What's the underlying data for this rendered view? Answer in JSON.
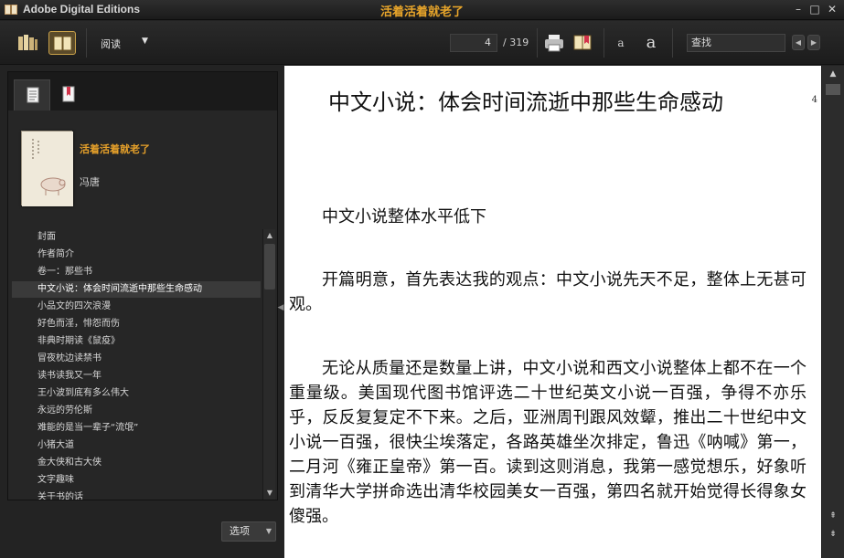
{
  "titlebar": {
    "app_name": "Adobe Digital Editions",
    "document_title": "活着活着就老了",
    "minimize": "–",
    "maximize": "□",
    "close": "✕"
  },
  "toolbar": {
    "view_menu_label": "阅读",
    "page_current": "4",
    "page_total": "/ 319",
    "search_placeholder": "查找",
    "font_smaller": "a",
    "font_larger": "a"
  },
  "library_panel": {
    "book_title": "活着活着就老了",
    "book_author": "冯唐",
    "toc": [
      "封面",
      "作者简介",
      "卷一：那些书",
      "中文小说：体会时间流逝中那些生命感动",
      "小品文的四次浪漫",
      "好色而淫，悱怨而伤",
      "非典时期读《鼠疫》",
      "冒夜枕边读禁书",
      "读书读我又一年",
      "王小波到底有多么伟大",
      "永远的劳伦斯",
      "难能的是当一辈子“流氓”",
      "小猪大道",
      "金大侠和古大侠",
      "文字趣味",
      "关于书的话"
    ],
    "selected_index": 3,
    "options_label": "选项"
  },
  "reader": {
    "chapter_heading": "中文小说：体会时间流逝中那些生命感动",
    "page_number": "4",
    "paragraphs": [
      "中文小说整体水平低下",
      "开篇明意，首先表达我的观点：中文小说先天不足，整体上无甚可观。",
      "无论从质量还是数量上讲，中文小说和西文小说整体上都不在一个重量级。美国现代图书馆评选二十世纪英文小说一百强，争得不亦乐乎，反反复复定不下来。之后，亚洲周刊跟风效颦，推出二十世纪中文小说一百强，很快尘埃落定，各路英雄坐次排定，鲁迅《呐喊》第一，二月河《雍正皇帝》第一百。读到这则消息，我第一感觉想乐，好象听到清华大学拼命选出清华校园美女一百强，第四名就开始觉得长得象女傻强。"
    ]
  },
  "colors": {
    "accent_orange": "#e8a52a",
    "chrome_dark": "#232323",
    "page_bg": "#ffffff"
  }
}
